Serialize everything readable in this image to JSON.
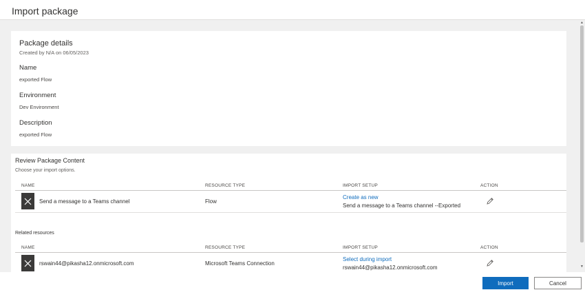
{
  "header": {
    "title": "Import package"
  },
  "package_details": {
    "title": "Package details",
    "created_by": "Created by N/A on 06/05/2023",
    "fields": [
      {
        "label": "Name",
        "value": "exported Flow"
      },
      {
        "label": "Environment",
        "value": "Dev Environment"
      },
      {
        "label": "Description",
        "value": "exported Flow"
      }
    ]
  },
  "review": {
    "title": "Review Package Content",
    "subtitle": "Choose your import options.",
    "columns": {
      "name": "NAME",
      "resource_type": "RESOURCE TYPE",
      "import_setup": "IMPORT SETUP",
      "action": "ACTION"
    },
    "rows": [
      {
        "icon": "close-x-icon",
        "name": "Send a message to a Teams channel",
        "resource_type": "Flow",
        "setup_link": "Create as new",
        "setup_detail": "Send a message to a Teams channel --Exported",
        "action_icon": "pencil-icon"
      }
    ]
  },
  "related": {
    "title": "Related resources",
    "columns": {
      "name": "NAME",
      "resource_type": "RESOURCE TYPE",
      "import_setup": "IMPORT SETUP",
      "action": "ACTION"
    },
    "rows": [
      {
        "icon": "close-x-icon",
        "name": "rswain44@pikasha12.onmicrosoft.com",
        "resource_type": "Microsoft Teams Connection",
        "setup_link": "Select during import",
        "setup_detail": "rswain44@pikasha12.onmicrosoft.com",
        "action_icon": "pencil-icon"
      }
    ]
  },
  "footer": {
    "import_label": "Import",
    "cancel_label": "Cancel"
  },
  "colors": {
    "accent": "#0f6cbd",
    "icon_bg": "#3b3a39",
    "content_bg": "#f0f0f0"
  }
}
